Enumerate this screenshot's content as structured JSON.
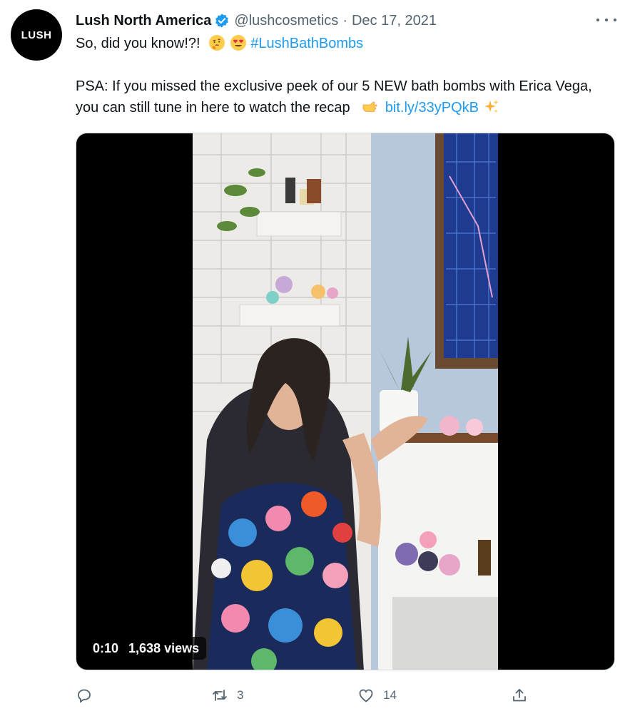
{
  "tweet": {
    "avatar_text": "LUSH",
    "author_name": "Lush North America",
    "verified": true,
    "handle": "@lushcosmetics",
    "separator": "·",
    "date": "Dec 17, 2021",
    "line1": "So, did you know!?!",
    "line1_emojis": [
      "thinking-face",
      "heart-eyes-face"
    ],
    "hashtag": "#LushBathBombs",
    "body_text": "PSA: If you missed the exclusive peek of our 5 NEW bath bombs with Erica Vega, you can still tune in here to watch the recap",
    "body_emoji": "backhand-index-pointing-right",
    "link": "bit.ly/33yPQkB",
    "trailing_emoji": "sparkles"
  },
  "video": {
    "time": "0:10",
    "views": "1,638 views"
  },
  "actions": {
    "reply_count": "",
    "retweet_count": "3",
    "like_count": "14",
    "share_count": ""
  },
  "colors": {
    "text": "#0f1419",
    "secondary": "#536471",
    "link": "#1d9bf0",
    "verified": "#1d9bf0"
  },
  "icons": [
    "more-icon",
    "verified-badge-icon",
    "reply-icon",
    "retweet-icon",
    "like-icon",
    "share-icon"
  ]
}
